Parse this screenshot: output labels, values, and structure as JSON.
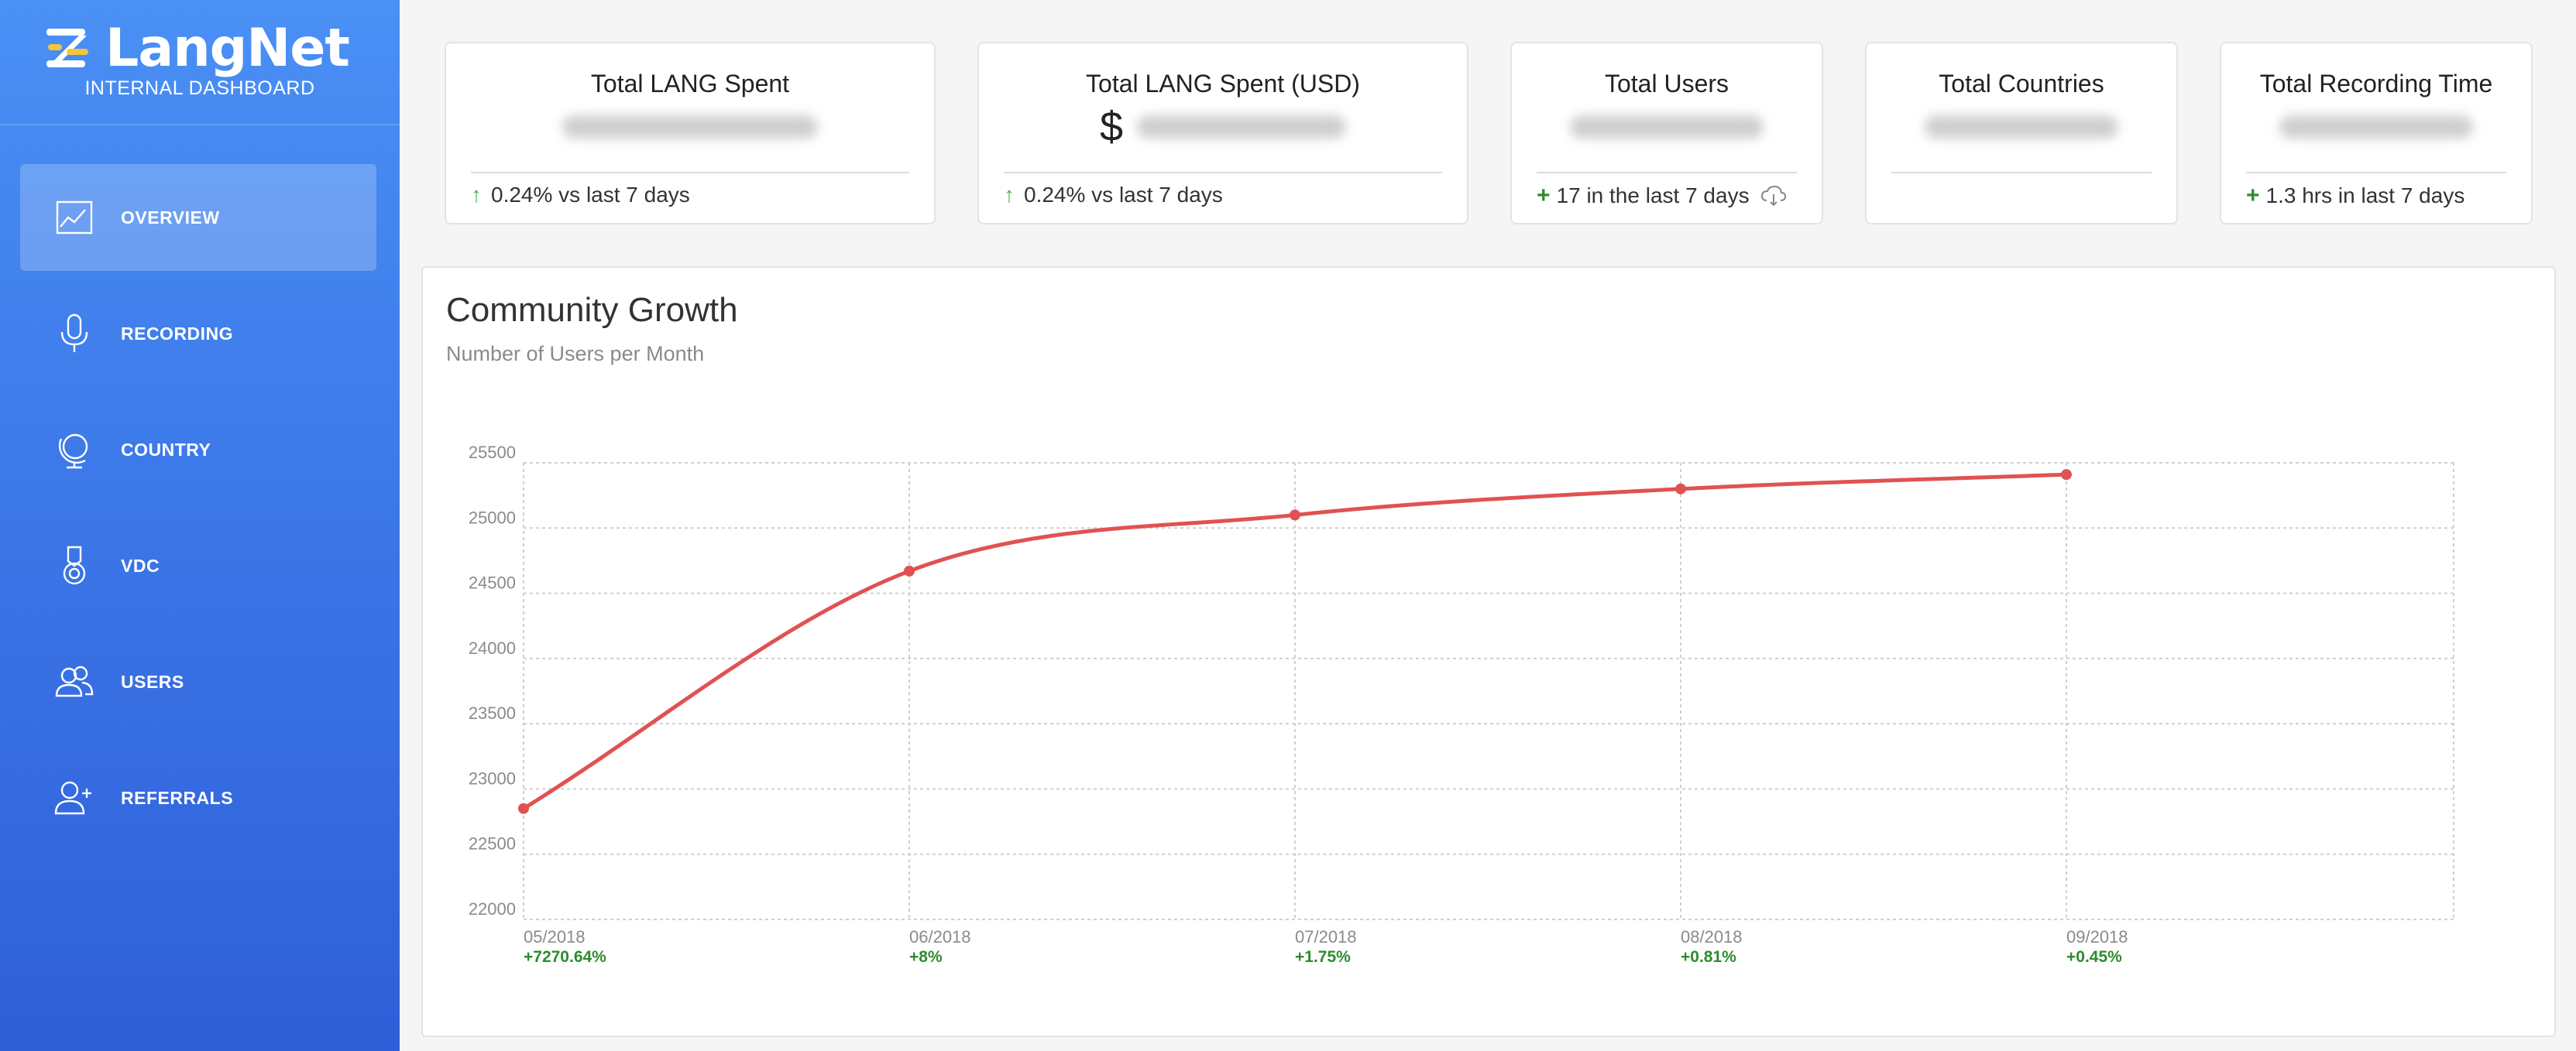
{
  "brand": {
    "name": "LangNet",
    "subtitle": "INTERNAL DASHBOARD"
  },
  "nav": [
    {
      "label": "OVERVIEW",
      "icon": "chart-line-icon",
      "active": true
    },
    {
      "label": "RECORDING",
      "icon": "microphone-icon",
      "active": false
    },
    {
      "label": "COUNTRY",
      "icon": "globe-icon",
      "active": false
    },
    {
      "label": "VDC",
      "icon": "medal-icon",
      "active": false
    },
    {
      "label": "USERS",
      "icon": "users-icon",
      "active": false
    },
    {
      "label": "REFERRALS",
      "icon": "user-plus-icon",
      "active": false
    }
  ],
  "cards": {
    "lang_spent": {
      "title": "Total LANG Spent",
      "foot": "0.24% vs last 7 days"
    },
    "lang_usd": {
      "title": "Total LANG Spent (USD)",
      "currency": "$",
      "foot": "0.24% vs last 7 days"
    },
    "users": {
      "title": "Total Users",
      "plus": "+",
      "foot": "17 in the last 7 days"
    },
    "countries": {
      "title": "Total Countries"
    },
    "recording": {
      "title": "Total Recording Time",
      "plus": "+",
      "foot": "1.3 hrs in last 7 days"
    }
  },
  "colors": {
    "accent": "#e05252",
    "positive": "#2e8b2e",
    "sidebar": "#3a74e6"
  },
  "chart": {
    "title": "Community Growth",
    "subtitle": "Number of Users per Month"
  },
  "chart_data": {
    "type": "line",
    "x": [
      "05/2018",
      "06/2018",
      "07/2018",
      "08/2018",
      "09/2018"
    ],
    "y": [
      22850,
      24670,
      25100,
      25300,
      25410
    ],
    "changes": [
      "+7270.64%",
      "+8%",
      "+1.75%",
      "+0.81%",
      "+0.45%"
    ],
    "ylim": [
      22000,
      25500
    ],
    "yticks": [
      22000,
      22500,
      23000,
      23500,
      24000,
      24500,
      25000,
      25500
    ],
    "grid": true,
    "color": "#e05252"
  }
}
